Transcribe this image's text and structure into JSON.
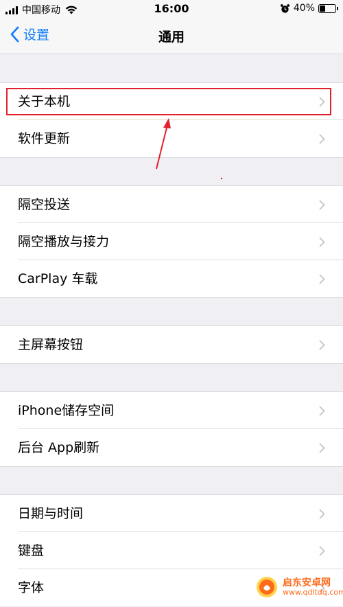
{
  "status_bar": {
    "carrier": "中国移动",
    "time": "16:00",
    "battery_text": "40%",
    "battery_level": 0.4
  },
  "nav": {
    "back_label": "设置",
    "title": "通用"
  },
  "groups": [
    {
      "items": [
        {
          "label": "关于本机"
        },
        {
          "label": "软件更新"
        }
      ]
    },
    {
      "items": [
        {
          "label": "隔空投送"
        },
        {
          "label": "隔空播放与接力"
        },
        {
          "label": "CarPlay 车载"
        }
      ]
    },
    {
      "items": [
        {
          "label": "主屏幕按钮"
        }
      ]
    },
    {
      "items": [
        {
          "label": "iPhone储存空间"
        },
        {
          "label": "后台 App刷新"
        }
      ]
    },
    {
      "items": [
        {
          "label": "日期与时间"
        },
        {
          "label": "键盘"
        },
        {
          "label": "字体"
        }
      ]
    }
  ],
  "annotation": {
    "highlight_color": "#e3202d",
    "arrow_color": "#e3202d"
  },
  "watermark": {
    "name": "启东安卓网",
    "url": "www.qdltdq.com"
  },
  "colors": {
    "accent": "#147efb",
    "background": "#efeff4"
  }
}
